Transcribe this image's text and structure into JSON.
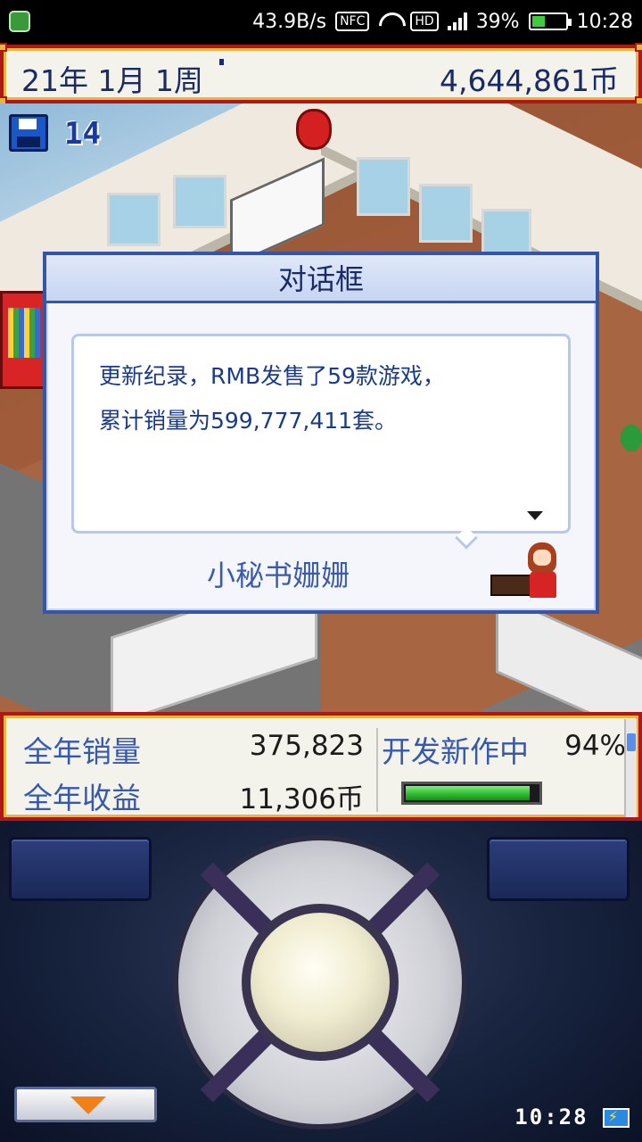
{
  "status_bar": {
    "net_speed": "43.9B/s",
    "nfc": "NFC",
    "hd": "HD",
    "battery": "39%",
    "time": "10:28"
  },
  "hud": {
    "date": "21年 1月 1周",
    "money": "4,644,861币"
  },
  "save": {
    "icon": "floppy-disk-icon",
    "count": "14"
  },
  "dialog": {
    "title": "对话框",
    "message_line1": "更新纪录，RMB发售了59款游戏，",
    "message_line2": "累计销量为599,777,411套。",
    "speaker": "小秘书姗姗"
  },
  "stats": {
    "annual_sales_label": "全年销量",
    "annual_sales_value": "375,823",
    "annual_revenue_label": "全年收益",
    "annual_revenue_value": "11,306币",
    "dev_label": "开发新作中",
    "dev_percent": "94%",
    "dev_progress": 0.94
  },
  "controller": {
    "clock": "10:28"
  },
  "colors": {
    "frame_red": "#b01818",
    "frame_gold": "#e6b640",
    "text_navy": "#1a2a66",
    "label_blue": "#3658b0",
    "progress_green": "#2cb82c"
  }
}
